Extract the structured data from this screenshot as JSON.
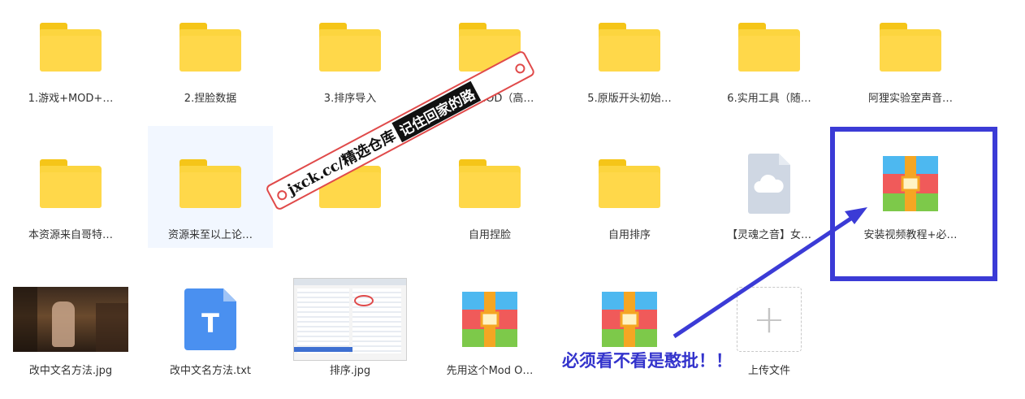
{
  "files": [
    {
      "type": "folder",
      "label": "1.游戏+MOD+…"
    },
    {
      "type": "folder",
      "label": "2.捏脸数据"
    },
    {
      "type": "folder",
      "label": "3.排序导入"
    },
    {
      "type": "folder",
      "label": "4.草地MOD（高…"
    },
    {
      "type": "folder",
      "label": "5.原版开头初始…"
    },
    {
      "type": "folder",
      "label": "6.实用工具（随…"
    },
    {
      "type": "folder",
      "label": "阿狸实验室声音…"
    },
    {
      "type": "folder",
      "label": "本资源来自哥特…"
    },
    {
      "type": "folder",
      "label": "资源来至以上论…",
      "selected": true
    },
    {
      "type": "folder",
      "label": ""
    },
    {
      "type": "folder",
      "label": "自用捏脸"
    },
    {
      "type": "folder",
      "label": "自用排序"
    },
    {
      "type": "cloud-file",
      "label": "【灵魂之音】女…"
    },
    {
      "type": "archive",
      "label": "安装视频教程+必…"
    },
    {
      "type": "image",
      "label": "改中文名方法.jpg"
    },
    {
      "type": "text-file",
      "icon_letter": "T",
      "label": "改中文名方法.txt"
    },
    {
      "type": "image",
      "label": "排序.jpg"
    },
    {
      "type": "archive",
      "label": "先用这个Mod O…"
    },
    {
      "type": "archive",
      "label": ""
    },
    {
      "type": "upload",
      "label": "上传文件"
    }
  ],
  "watermark": {
    "text": "jxck.cc/精选仓库",
    "highlight": "记住回家的路"
  },
  "annotation": {
    "text": "必须看不看是憨批！！"
  },
  "colors": {
    "folder": "#fcd53f",
    "accent": "#3b3bd6",
    "watermark_border": "#e04a4a"
  }
}
